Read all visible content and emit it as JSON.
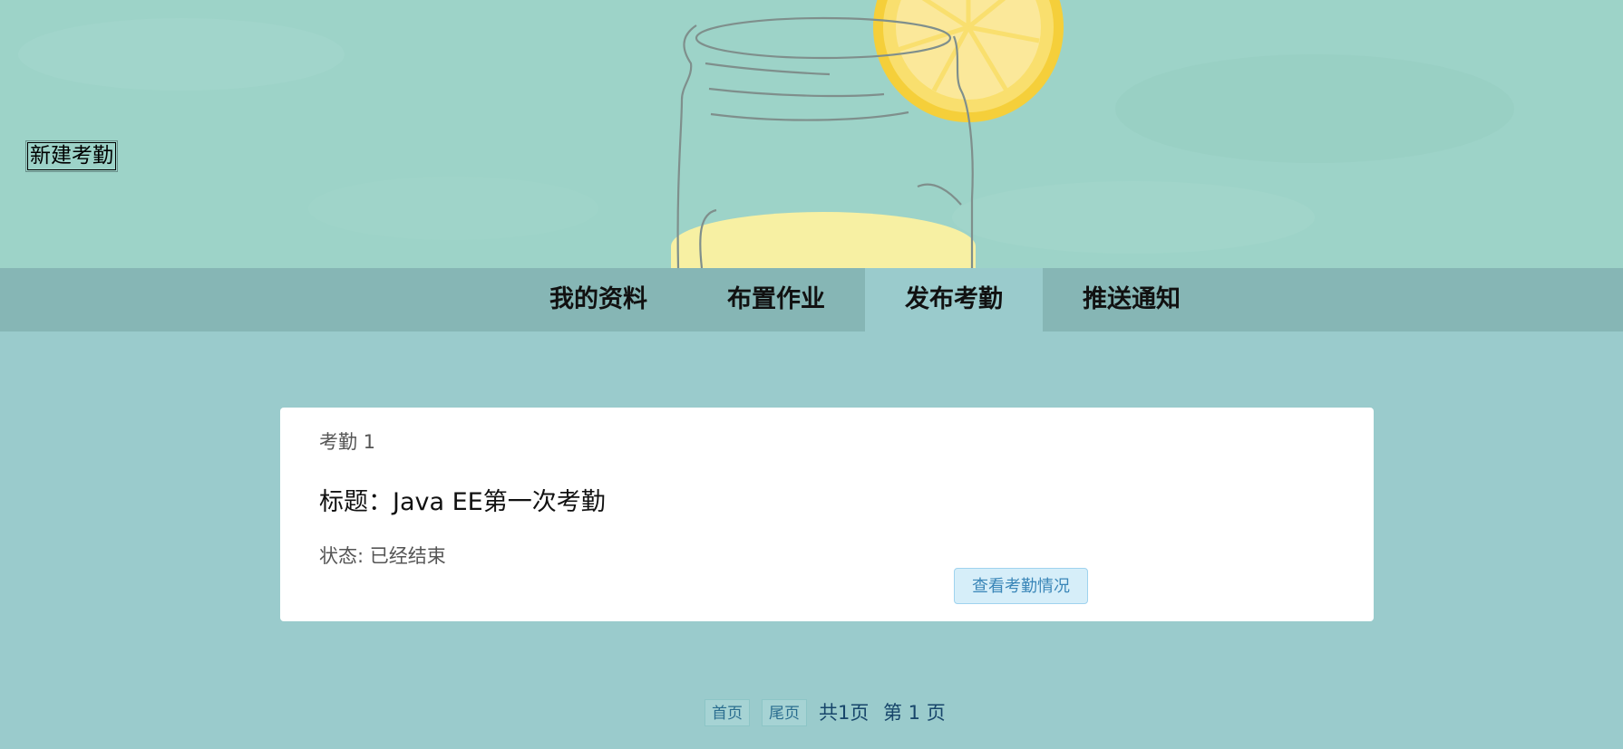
{
  "header": {
    "new_attendance_button": "新建考勤"
  },
  "nav": {
    "items": [
      {
        "label": "我的资料"
      },
      {
        "label": "布置作业"
      },
      {
        "label": "发布考勤"
      },
      {
        "label": "推送通知"
      }
    ],
    "active_label": "发布考勤"
  },
  "attendance_card": {
    "index_label": "考勤 1",
    "title": "标题：Java EE第一次考勤",
    "status": "状态: 已经结束",
    "view_button": "查看考勤情况"
  },
  "pagination": {
    "first_label": "首页",
    "last_label": "尾页",
    "total_pages_text": "共1页",
    "current_page_text": "第 1 页"
  },
  "colors": {
    "page_background": "#9acbcc",
    "nav_background": "#86b6b5",
    "banner_background": "#9dd3c8",
    "lemon": "#f6d96a"
  }
}
